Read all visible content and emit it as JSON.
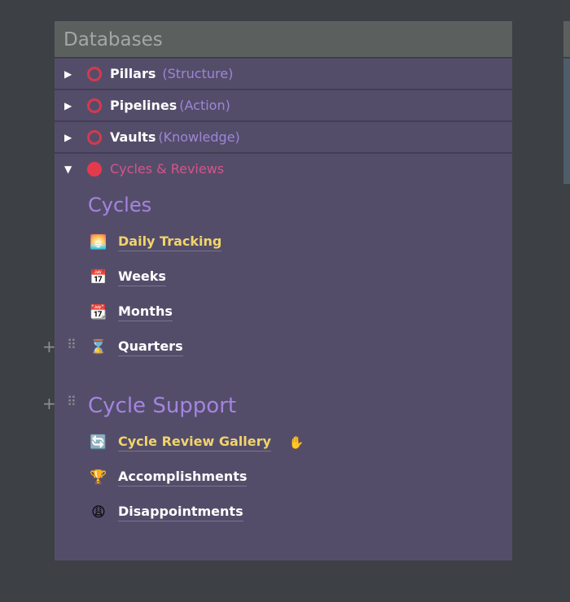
{
  "panel": {
    "title": "Databases",
    "rows": [
      {
        "name": "Pillars",
        "sub": "(Structure)",
        "icon": "red-ring-icon",
        "expanded": false
      },
      {
        "name": "Pipelines",
        "sub": "(Action)",
        "icon": "red-ring-icon",
        "expanded": false
      },
      {
        "name": "Vaults",
        "sub": "(Knowledge)",
        "icon": "red-ring-icon",
        "expanded": false
      },
      {
        "name": "Cycles & Reviews",
        "icon": "red-circle-icon",
        "expanded": true
      }
    ],
    "cycles": {
      "heading": "Cycles",
      "items": [
        {
          "label": "Daily Tracking",
          "icon": "sunrise-icon",
          "highlight": true
        },
        {
          "label": "Weeks",
          "icon": "calendar-icon"
        },
        {
          "label": "Months",
          "icon": "calendar-21-icon",
          "icon_text": "21"
        },
        {
          "label": "Quarters",
          "icon": "hourglass-icon"
        }
      ]
    },
    "support": {
      "heading": "Cycle Support",
      "items": [
        {
          "label": "Cycle Review Gallery",
          "icon": "recycle-arrows-icon",
          "highlight": true
        },
        {
          "label": "Accomplishments",
          "icon": "trophy-icon"
        },
        {
          "label": "Disappointments",
          "icon": "weary-face-icon"
        }
      ]
    }
  },
  "colors": {
    "accent": "#a584e0",
    "link_highlight": "#f1d46b",
    "status_red": "#e5394d"
  }
}
